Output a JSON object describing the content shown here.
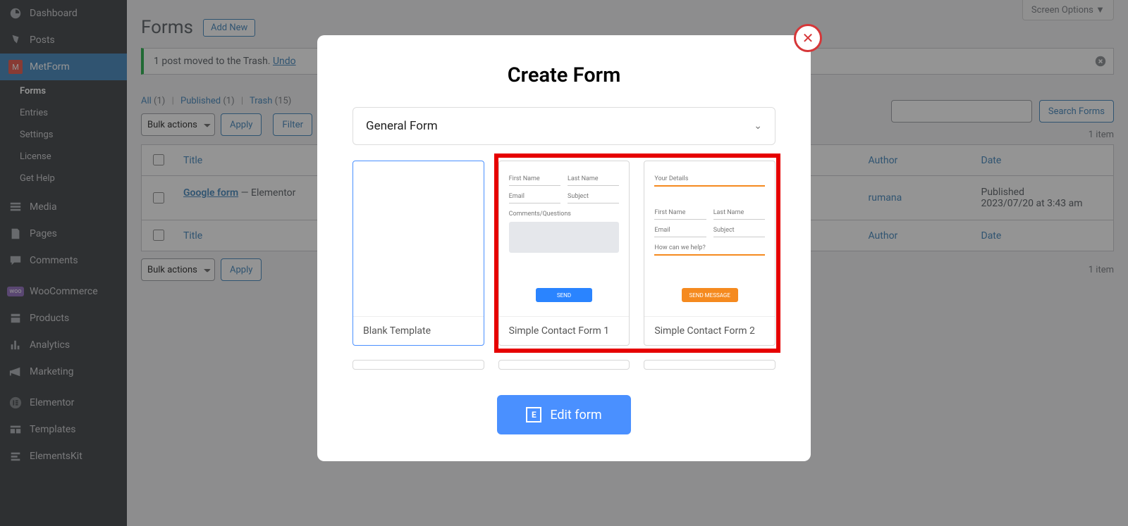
{
  "sidebar": {
    "items": [
      {
        "label": "Dashboard",
        "icon": "dashboard"
      },
      {
        "label": "Posts",
        "icon": "pin"
      },
      {
        "label": "MetForm",
        "icon": "metform",
        "active": true
      },
      {
        "label": "Media",
        "icon": "media"
      },
      {
        "label": "Pages",
        "icon": "pages"
      },
      {
        "label": "Comments",
        "icon": "comments"
      },
      {
        "label": "WooCommerce",
        "icon": "woo"
      },
      {
        "label": "Products",
        "icon": "products"
      },
      {
        "label": "Analytics",
        "icon": "analytics"
      },
      {
        "label": "Marketing",
        "icon": "marketing"
      },
      {
        "label": "Elementor",
        "icon": "elementor"
      },
      {
        "label": "Templates",
        "icon": "templates"
      },
      {
        "label": "ElementsKit",
        "icon": "elementskit"
      }
    ],
    "sub": [
      {
        "label": "Forms",
        "current": true
      },
      {
        "label": "Entries"
      },
      {
        "label": "Settings"
      },
      {
        "label": "License"
      },
      {
        "label": "Get Help"
      }
    ]
  },
  "screen_options": "Screen Options",
  "page": {
    "title": "Forms",
    "add_new": "Add New"
  },
  "notice": {
    "text": "1 post moved to the Trash. ",
    "undo": "Undo"
  },
  "views": {
    "all_label": "All",
    "all_count": "(1)",
    "published_label": "Published",
    "published_count": "(1)",
    "trash_label": "Trash",
    "trash_count": "(15)"
  },
  "bulk_select": "Bulk actions",
  "apply_label": "Apply",
  "filter_label": "Filter",
  "search": {
    "placeholder": "",
    "button": "Search Forms"
  },
  "item_count": "1 item",
  "table": {
    "cols": {
      "title": "Title",
      "author": "Author",
      "date": "Date"
    },
    "row": {
      "title": "Google form",
      "suffix": " — Elementor",
      "author": "rumana",
      "date_status": "Published",
      "date_value": "2023/07/20 at 3:43 am"
    }
  },
  "modal": {
    "title": "Create Form",
    "select_value": "General Form",
    "templates": [
      {
        "label": "Blank Template"
      },
      {
        "label": "Simple Contact Form 1"
      },
      {
        "label": "Simple Contact Form 2"
      }
    ],
    "preview1": {
      "first_name": "First Name",
      "last_name": "Last Name",
      "email": "Email",
      "subject": "Subject",
      "comments": "Comments/Questions",
      "send": "SEND"
    },
    "preview2": {
      "your_details": "Your Details",
      "first_name": "First Name",
      "last_name": "Last Name",
      "email": "Email",
      "subject": "Subject",
      "help": "How can we help?",
      "send": "SEND MESSAGE"
    },
    "edit_btn": "Edit form"
  }
}
